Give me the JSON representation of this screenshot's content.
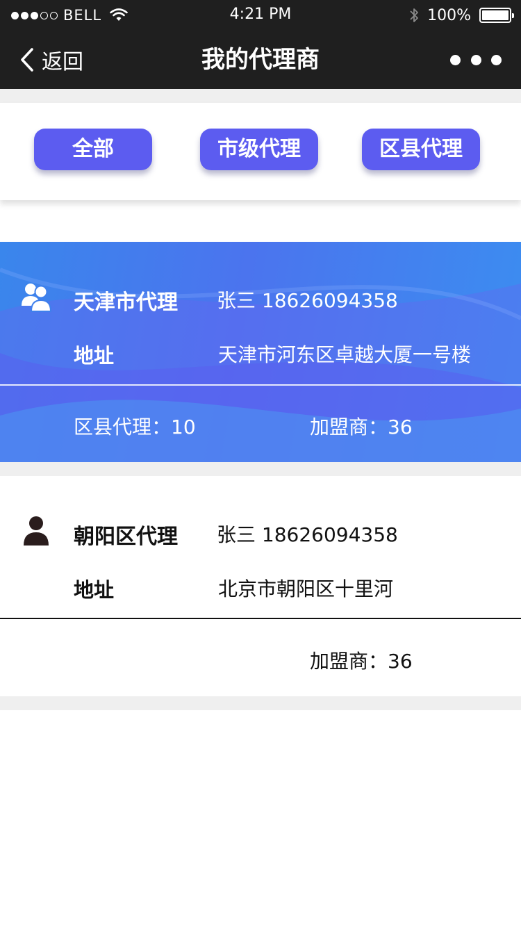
{
  "status_bar": {
    "carrier": "BELL",
    "time": "4:21 PM",
    "battery_pct": "100%",
    "signal_bars_filled": 3,
    "signal_bars_total": 5
  },
  "nav": {
    "back_label": "返回",
    "title": "我的代理商",
    "more_icon": "more-dots-icon"
  },
  "filters": {
    "buttons": [
      {
        "label": "全部"
      },
      {
        "label": "市级代理"
      },
      {
        "label": "区县代理"
      }
    ],
    "button_color": "#5c5cf0"
  },
  "agents": [
    {
      "name": "天津市代理",
      "contact": "张三 18626094358",
      "address_label": "地址",
      "address": "天津市河东区卓越大厦一号楼",
      "stat_left": "区县代理：10",
      "stat_right": "加盟商：36",
      "icon": "group-users-icon",
      "highlighted": true,
      "card_color": "#3a86ec"
    },
    {
      "name": "朝阳区代理",
      "contact": "张三 18626094358",
      "address_label": "地址",
      "address": "北京市朝阳区十里河",
      "stat_right": "加盟商：36",
      "icon": "user-icon",
      "highlighted": false
    }
  ]
}
